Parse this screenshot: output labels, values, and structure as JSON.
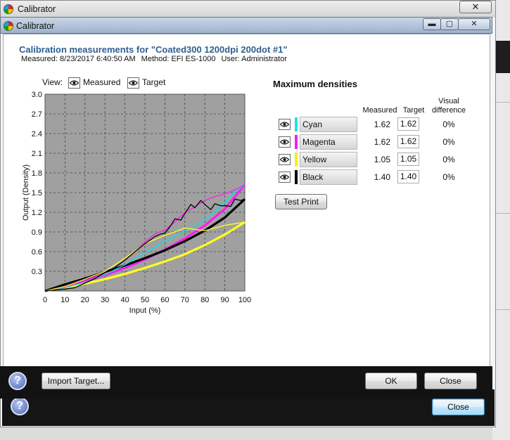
{
  "outer_window": {
    "title": "Calibrator",
    "close_label": "✕",
    "help_label": "?",
    "close_button": "Close"
  },
  "dialog": {
    "title": "Calibrator",
    "minimize_label": "▬",
    "maximize_label": "▢",
    "close_label": "✕",
    "heading": "Calibration measurements for \"Coated300 1200dpi  200dot #1\"",
    "measured_text": "Measured: 8/23/2017 6:40:50 AM",
    "method_text": "Method: EFI ES-1000",
    "user_text": "User: Administrator"
  },
  "view": {
    "label": "View:",
    "measured": "Measured",
    "target": "Target"
  },
  "chart_data": {
    "type": "line",
    "xlabel": "Input (%)",
    "ylabel": "Output (Density)",
    "xlim": [
      0,
      100
    ],
    "ylim": [
      0,
      3.0
    ],
    "x_ticks": [
      "0",
      "10",
      "20",
      "30",
      "40",
      "50",
      "60",
      "70",
      "80",
      "90",
      "100"
    ],
    "y_ticks": [
      "0.3",
      "0.6",
      "0.9",
      "1.2",
      "1.5",
      "1.8",
      "2.1",
      "2.4",
      "2.7",
      "3.0"
    ],
    "grid": true,
    "background": "#a0a0a0",
    "series": [
      {
        "role": "target",
        "color": "#00e5f0",
        "x": [
          0,
          10,
          20,
          30,
          40,
          50,
          60,
          70,
          80,
          90,
          100
        ],
        "y": [
          0,
          0.07,
          0.15,
          0.24,
          0.35,
          0.48,
          0.63,
          0.8,
          1.0,
          1.25,
          1.62
        ]
      },
      {
        "role": "target",
        "color": "#ff1ee8",
        "x": [
          0,
          10,
          20,
          30,
          40,
          50,
          60,
          70,
          80,
          90,
          100
        ],
        "y": [
          0,
          0.07,
          0.15,
          0.24,
          0.35,
          0.48,
          0.63,
          0.8,
          1.0,
          1.25,
          1.62
        ]
      },
      {
        "role": "target",
        "color": "#ffff22",
        "x": [
          0,
          10,
          20,
          30,
          40,
          50,
          60,
          70,
          80,
          90,
          100
        ],
        "y": [
          0,
          0.05,
          0.11,
          0.18,
          0.26,
          0.35,
          0.45,
          0.56,
          0.7,
          0.86,
          1.05
        ]
      },
      {
        "role": "target",
        "color": "#000000",
        "x": [
          0,
          10,
          20,
          30,
          40,
          50,
          60,
          70,
          80,
          90,
          100
        ],
        "y": [
          0,
          0.1,
          0.19,
          0.29,
          0.39,
          0.5,
          0.62,
          0.76,
          0.92,
          1.12,
          1.4
        ]
      },
      {
        "role": "measured",
        "color": "#00e5f0",
        "x": [
          0,
          10,
          20,
          30,
          40,
          50,
          60,
          70,
          75,
          80,
          85,
          90,
          95,
          100
        ],
        "y": [
          0,
          0.05,
          0.13,
          0.25,
          0.4,
          0.58,
          0.76,
          0.92,
          0.98,
          1.1,
          1.2,
          1.35,
          1.5,
          1.62
        ]
      },
      {
        "role": "measured",
        "color": "#ff1ee8",
        "x": [
          0,
          10,
          20,
          30,
          35,
          40,
          45,
          50,
          55,
          60,
          65,
          70,
          75,
          80,
          85,
          90,
          95,
          100
        ],
        "y": [
          0,
          0.06,
          0.16,
          0.28,
          0.36,
          0.47,
          0.6,
          0.75,
          0.87,
          0.93,
          1.05,
          1.2,
          1.28,
          1.38,
          1.44,
          1.48,
          1.54,
          1.62
        ]
      },
      {
        "role": "measured",
        "color": "#ffff22",
        "x": [
          0,
          10,
          20,
          30,
          40,
          50,
          60,
          65,
          70,
          80,
          90,
          100
        ],
        "y": [
          0,
          0.07,
          0.18,
          0.3,
          0.5,
          0.72,
          0.85,
          0.9,
          0.96,
          0.92,
          1.0,
          1.05
        ]
      },
      {
        "role": "measured",
        "color": "#000000",
        "x": [
          0,
          10,
          15,
          20,
          25,
          30,
          35,
          40,
          45,
          50,
          55,
          58,
          60,
          63,
          65,
          68,
          70,
          73,
          75,
          78,
          80,
          83,
          85,
          88,
          90,
          93,
          95,
          98,
          100
        ],
        "y": [
          0,
          0.03,
          0.05,
          0.12,
          0.19,
          0.28,
          0.36,
          0.47,
          0.6,
          0.72,
          0.83,
          0.87,
          0.88,
          1.0,
          1.1,
          1.08,
          1.18,
          1.32,
          1.27,
          1.38,
          1.32,
          1.24,
          1.33,
          1.3,
          1.3,
          1.29,
          1.4,
          1.38,
          1.4
        ]
      }
    ]
  },
  "max_densities": {
    "title": "Maximum densities",
    "col_measured": "Measured",
    "col_target": "Target",
    "col_visual_1": "Visual",
    "col_visual_2": "difference",
    "inks": [
      {
        "name": "Cyan",
        "color": "#22e0ea",
        "measured": "1.62",
        "target": "1.62",
        "visual": "0%"
      },
      {
        "name": "Magenta",
        "color": "#ee22ee",
        "measured": "1.62",
        "target": "1.62",
        "visual": "0%"
      },
      {
        "name": "Yellow",
        "color": "#f5f21a",
        "measured": "1.05",
        "target": "1.05",
        "visual": "0%"
      },
      {
        "name": "Black",
        "color": "#000000",
        "measured": "1.40",
        "target": "1.40",
        "visual": "0%"
      }
    ],
    "test_print": "Test Print"
  },
  "footer": {
    "help_label": "?",
    "import_target": "Import Target...",
    "ok": "OK",
    "close": "Close"
  }
}
